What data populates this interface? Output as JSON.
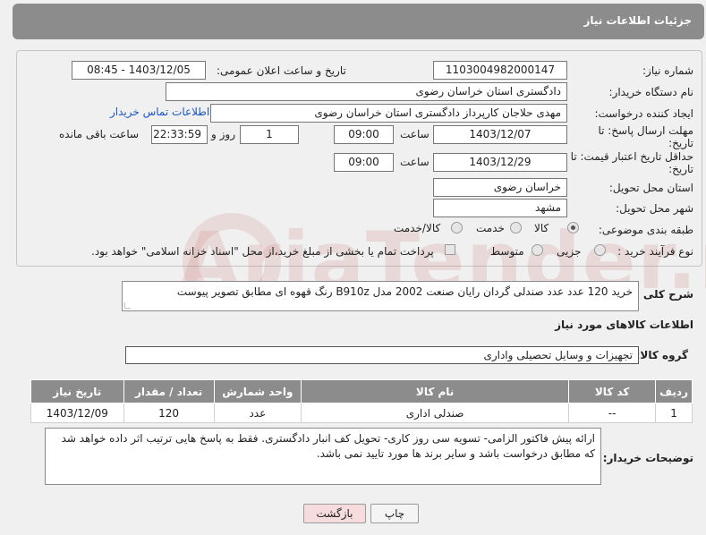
{
  "header": {
    "title": "جزئیات اطلاعات نیاز"
  },
  "form": {
    "need_number_label": "شماره نیاز:",
    "need_number": "1103004982000147",
    "announce_label": "تاریخ و ساعت اعلان عمومی:",
    "announce_value": "1403/12/05 - 08:45",
    "buyer_org_label": "نام دستگاه خریدار:",
    "buyer_org": "دادگستری استان خراسان رضوی",
    "requester_label": "ایجاد کننده درخواست:",
    "requester": "مهدی حلاجان کارپرداز دادگستری استان خراسان رضوی",
    "contact_link": "اطلاعات تماس خریدار",
    "deadline_label_1": "مهلت ارسال پاسخ: تا",
    "deadline_label_2": "تاریخ:",
    "deadline_date": "1403/12/07",
    "time_label": "ساعت",
    "deadline_time": "09:00",
    "days_value": "1",
    "days_label": "روز و",
    "remaining_time": "22:33:59",
    "remaining_label": "ساعت باقی مانده",
    "validity_label_1": "حداقل تاریخ اعتبار قیمت: تا",
    "validity_label_2": "تاریخ:",
    "validity_date": "1403/12/29",
    "validity_time_label": "ساعت",
    "validity_time": "09:00",
    "province_label": "استان محل تحویل:",
    "province": "خراسان رضوی",
    "city_label": "شهر محل تحویل:",
    "city": "مشهد",
    "category_label": "طبقه بندی موضوعی:",
    "category_options": [
      "کالا",
      "خدمت",
      "کالا/خدمت"
    ],
    "category_selected": "کالا",
    "process_label": "نوع فرآیند خرید :",
    "process_options": [
      "جزیی",
      "متوسط"
    ],
    "payment_note": "پرداخت تمام یا بخشی از مبلغ خرید،از محل \"اسناد خزانه اسلامی\" خواهد بود."
  },
  "description": {
    "label": "شرح کلی نیاز:",
    "text": "خرید 120 عدد عدد صندلی گردان رایان صنعت 2002 مدل B910z رنگ قهوه ای مطابق تصویر پیوست"
  },
  "goods": {
    "section_title": "اطلاعات کالاهای مورد نیاز",
    "group_label": "گروه کالا:",
    "group_value": "تجهیزات و وسایل تحصیلی واداری",
    "columns": [
      "ردیف",
      "کد کالا",
      "نام کالا",
      "واحد شمارش",
      "تعداد / مقدار",
      "تاریخ نیاز"
    ],
    "rows": [
      [
        "1",
        "--",
        "صندلی اداری",
        "عدد",
        "120",
        "1403/12/09"
      ]
    ]
  },
  "buyer_notes": {
    "label": "توضیحات خریدار:",
    "text": "ارائه پیش فاکتور الزامی- تسویه سی روز کاری- تحویل کف انبار دادگستری. فقط به پاسخ هایی ترتیب اثر داده خواهد شد که مطابق درخواست باشد و سایر برند ها مورد تایید نمی باشد."
  },
  "buttons": {
    "print": "چاپ",
    "back": "بازگشت"
  },
  "watermark": "AriaTender.neT",
  "colors": {
    "header_bg": "#8c8c8c",
    "link": "#1a56c4",
    "back_button": "#f6dcdc"
  }
}
